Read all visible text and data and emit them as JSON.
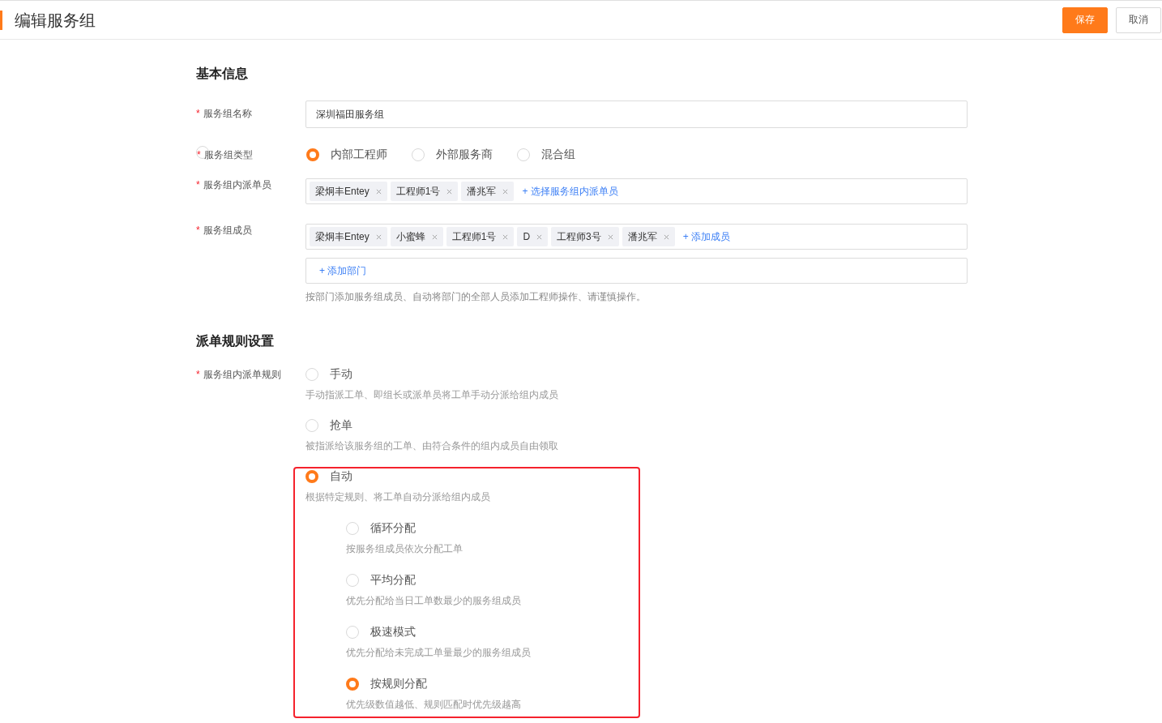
{
  "header": {
    "title": "编辑服务组",
    "buttons": [
      {
        "label": "保存",
        "kind": "primary"
      },
      {
        "label": "取消",
        "kind": "default"
      }
    ]
  },
  "sections": [
    {
      "title": "基本信息",
      "fields": [
        {
          "kind": "text",
          "required_mark": "*",
          "label": "服务组名称",
          "value": "深圳福田服务组"
        },
        {
          "kind": "radio",
          "required_mark": "*",
          "label": "服务组类型",
          "options": [
            {
              "label": "内部工程师",
              "selected": true
            },
            {
              "label": "外部服务商",
              "selected": false
            },
            {
              "label": "混合组",
              "selected": false
            }
          ]
        },
        {
          "kind": "tags",
          "required_mark": "*",
          "label": "服务组内派单员",
          "tags": [
            "梁炯丰Entey",
            "工程师1号",
            "潘兆军"
          ],
          "add_link": "+ 选择服务组内派单员"
        },
        {
          "kind": "tags",
          "required_mark": "*",
          "label": "服务组成员",
          "tags": [
            "梁炯丰Entey",
            "小蜜蜂",
            "工程师1号",
            "D",
            "工程师3号",
            "潘兆军"
          ],
          "add_link": "+ 添加成员",
          "extra_link": "+ 添加部门",
          "hint": "按部门添加服务组成员、自动将部门的全部人员添加工程师操作、请谨慎操作。"
        }
      ]
    },
    {
      "title": "派单规则设置",
      "fields": [
        {
          "kind": "rules",
          "required_mark": "*",
          "label": "服务组内派单规则",
          "options": [
            {
              "label": "手动",
              "description": "手动指派工单、即组长或派单员将工单手动分派给组内成员",
              "selected": false,
              "highlighted": false
            },
            {
              "label": "抢单",
              "description": "被指派给该服务组的工单、由符合条件的组内成员自由领取",
              "selected": false,
              "highlighted": false
            },
            {
              "label": "自动",
              "description": "根据特定规则、将工单自动分派给组内成员",
              "selected": true,
              "highlighted": true,
              "children": [
                {
                  "label": "循环分配",
                  "description": "按服务组成员依次分配工单",
                  "selected": false
                },
                {
                  "label": "平均分配",
                  "description": "优先分配给当日工单数最少的服务组成员",
                  "selected": false
                },
                {
                  "label": "极速模式",
                  "description": "优先分配给未完成工单量最少的服务组成员",
                  "selected": false
                },
                {
                  "label": "按规则分配",
                  "description": "优先级数值越低、规则匹配时优先级越高",
                  "selected": true
                }
              ]
            }
          ]
        }
      ]
    }
  ]
}
